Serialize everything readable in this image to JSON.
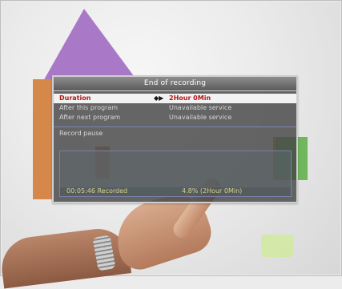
{
  "dialog": {
    "title": "End of recording",
    "rows": [
      {
        "label": "Duration",
        "value": "2Hour 0Min",
        "selected": true
      },
      {
        "label": "After this program",
        "value": "Unavailable service"
      },
      {
        "label": "After next program",
        "value": "Unavailable service"
      }
    ],
    "section_label": "Record pause",
    "status": {
      "recorded": "00:05:46 Recorded",
      "progress": "4.8% (2Hour 0Min)"
    }
  },
  "colors": {
    "selected_text": "#b31818",
    "status_text": "#d4d08d",
    "panel_bg": "#464646"
  },
  "icons": {
    "selector_arrows": "◆▶"
  }
}
